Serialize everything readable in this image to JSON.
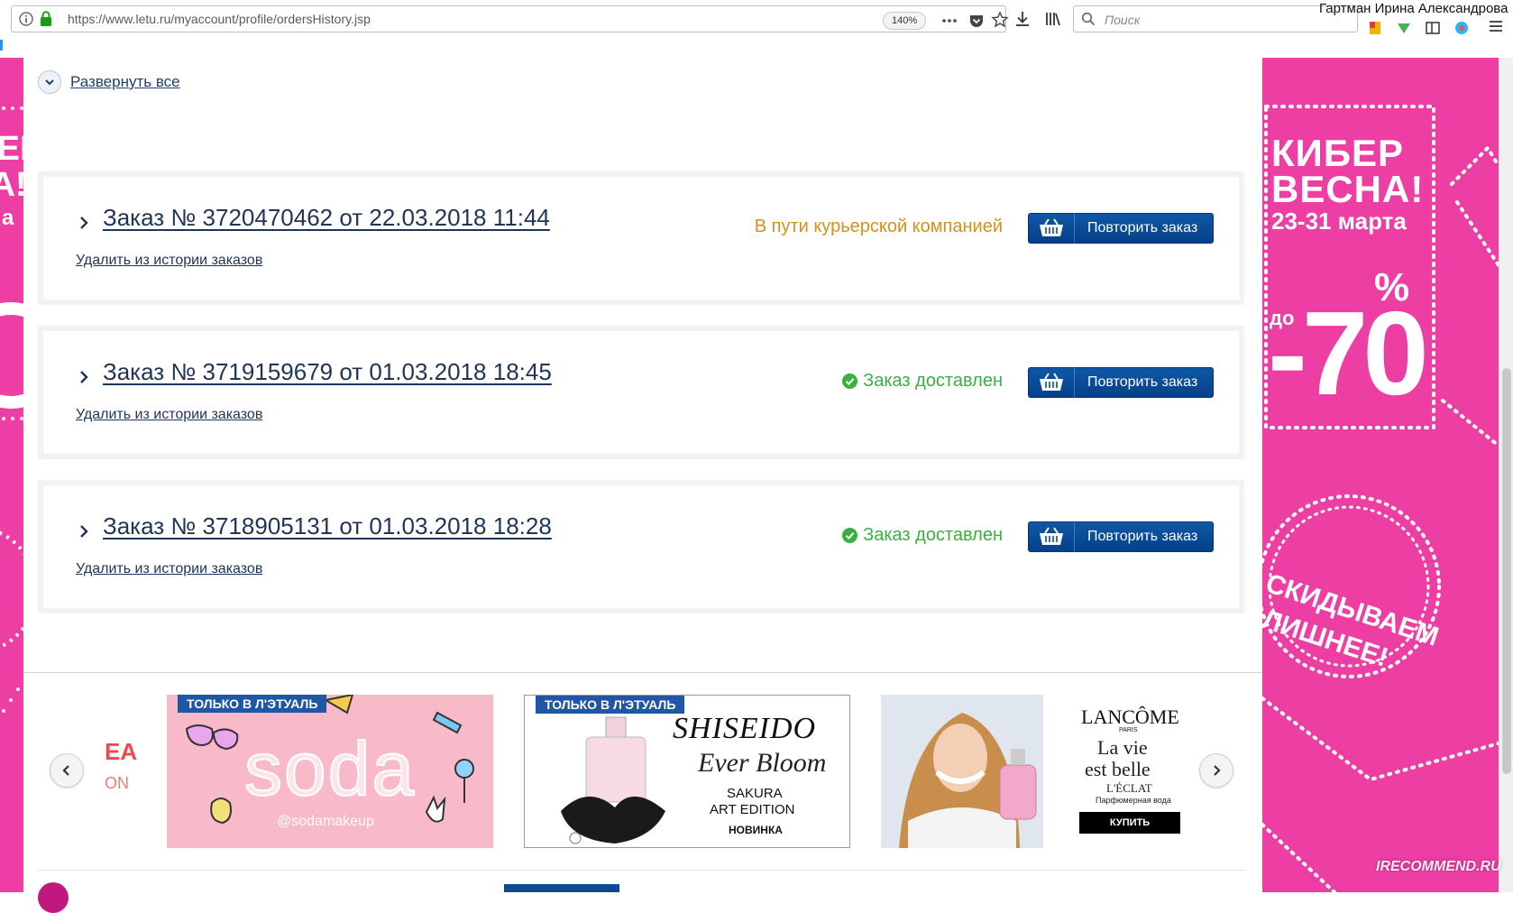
{
  "browser": {
    "url": "https://www.letu.ru/myaccount/profile/ordersHistory.jsp",
    "zoom": "140%",
    "search_placeholder": "Поиск",
    "user_name": "Гартман Ирина Александрова"
  },
  "page": {
    "expand_all_label": "Развернуть все"
  },
  "orders": [
    {
      "title": "Заказ № 3720470462 от 22.03.2018 11:44",
      "status": "В пути курьерской компанией",
      "status_color": "#d6901a",
      "status_delivered": false,
      "remove_label": "Удалить из истории заказов",
      "repeat_label": "Повторить заказ"
    },
    {
      "title": "Заказ № 3719159679 от 01.03.2018 18:45",
      "status": "Заказ доставлен",
      "status_color": "#3ab03e",
      "status_delivered": true,
      "remove_label": "Удалить из истории заказов",
      "repeat_label": "Повторить заказ"
    },
    {
      "title": "Заказ № 3718905131 от 01.03.2018 18:28",
      "status": "Заказ доставлен",
      "status_color": "#3ab03e",
      "status_delivered": true,
      "remove_label": "Удалить из истории заказов",
      "repeat_label": "Повторить заказ"
    }
  ],
  "promo_right": {
    "headline1": "КИБЕР",
    "headline2": "ВЕСНА!",
    "dates": "23-31 марта",
    "prefix": "до",
    "discount": "-70",
    "percent": "%",
    "circle_line1": "СКИДЫВАЕМ",
    "circle_line2": "ЛИШНЕЕ!"
  },
  "promo_left": {
    "fragment1": "ИБЕР",
    "fragment2": "НА!",
    "fragment3": "а"
  },
  "carousel": {
    "partial_text1": "EA",
    "partial_text2": "ON",
    "banners": [
      {
        "ribbon": "ТОЛЬКО В Л'ЭТУАЛЬ",
        "brand": "soda",
        "handle": "@sodamakeup"
      },
      {
        "ribbon": "ТОЛЬКО В Л'ЭТУАЛЬ",
        "brand": "SHISEIDO",
        "line1": "Ever Bloom",
        "line2": "SAKURA",
        "line3": "ART EDITION",
        "line4": "НОВИНКА"
      },
      {
        "brand": "LANCÔME",
        "brand_sub": "PARIS",
        "line1": "La vie",
        "line2": "est belle",
        "line3": "L'ÉCLAT",
        "line4": "Парфюмерная вода",
        "cta": "КУПИТЬ"
      }
    ]
  },
  "watermark": "IRECOMMEND.RU",
  "colors": {
    "promo_pink": "#ed3ea3",
    "button_blue": "#0a4d99",
    "link_navy": "#1f3556"
  }
}
